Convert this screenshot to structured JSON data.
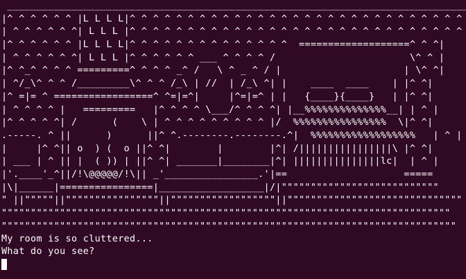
{
  "terminal": {
    "background_color": "#300a24",
    "text_color": "#ffffff",
    "art_lines": [
      " _______________________________________________________________________________________",
      "|^ ^ ^ ^ ^ ^ |L L L L|^ ^ ^ ^ ^ ^ ^ ^ ^ ^ ^ ^ ^ ^ ^ ^ ^ ^ ^ ^ ^ ^ ^ ^ ^ ^ ^ ^ ^ ^ ^ |",
      "| ^ ^ ^ ^ ^ ^| L L L |^ ^ ^ ^ ^ ^ ^ ^ ^ ^ ^ ^ ^ ^ ^ ^ ^ ^ ^ ^ ^ ^ ^ ^ ^ ^ ^ ^ ^ ^ |",
      "|^ ^ ^ ^ ^ ^ |L L L L|^ ^ ^ ^ ^ ^ ^ ^ ^ ^ ^ ^ ^ ^  ===================^ ^ ^|",
      "| ^ ^ ^ ^ ^ ^| L L L |^ ^ ^ ^ ^ ^ ___ ^ ^ ^ ^ /                       \\^ ^ |",
      "|^ ^_^ ^ ^ ^ =========^ ^ ^ ^ _^ /   \\ ^ _ ^ / |                     | \\^ ^|",
      "| ^/_\\^ ^ ^ /_________\\^ ^ ^ /_\\ | //  | /_\\ ^| |    ____  ____    | |^ ^|",
      "|^ =|= ^ =================^ ^=|=^|     |^=|=^ | |   {____}{____}   | |^ ^|",
      "| ^ ^ ^ ^ |   =========   |^ ^ ^ ^ \\___/^ ^ ^ ^| |__%%%%%%%%%%%%%%__| | ^ |",
      "|^ ^ ^ ^ ^| /      (    \\ | ^ ^ ^ ^ ^ ^ ^ ^ ^ |/  %%%%%%%%%%%%%%%%  \\|^ ^|",
      ".-----. ^ ||      )      ||^ ^.--------.--------.^|  %%%%%%%%%%%%%%%%%%   | ^ |",
      "|     |^ ^|| o  ) (  o ||^ ^|        |        |^| /||||||||||||||||\\ |^ ^|",
      "| ___ | ^ || |  ( )) | ||^ ^| _______|________|^| |||||||||||||||lc|  | ^ |",
      "|'.____'_^||/!\\@@@@@/!\\|| _'________________.'|==                    =====",
      "|\\|______|================|__________________|/|\"\"\"\"\"\"\"\"\"\"\"\"\"\"\"\"\"\"\"\"\"\"\"\"\"\"\"",
      "\" ||\"\"\"\"\"||\"\"\"\"\"\"\"\"\"\"\"\"\"\"\"\"||\"\"\"\"\"\"\"\"\"\"\"\"\"\"\"\"\"\"||\"\"\"\"\"\"\"\"\"\"\"\"\"\"\"\"\"\"\"\"\"\"\"\"\"\"\"\"\"\"",
      "\"\"\"\"\"\"\"\"\"\"\"\"\"\"\"\"\"\"\"\"\"\"\"\"\"\"\"\"\"\"\"\"\"\"\"\"\"\"\"\"\"\"\"\"\"\"\"\"\"\"\"\"\"\"\"\"\"\"\"\"\"\"\"\"\"\"\"\"\"\"\"\"\"\"\"\"\"",
      "\"\"\"\"\"\"\"\"\"\"\"\"\"\"\"\"\"\"\"\"\"\"\"\"\"\"\"\"\"\"\"\"\"\"\"\"\"\"\"\"\"\"\"\"\"\"\"\"\"\"\"\"\"\"\"\"\"\"\"\"\"\"\"\"\"\"\"\"\"\"\"\"\"\"\"\"\"\"",
      "\"\"\"\"\"\"\"\"\"\"\"\"\"\"\"\"\"\"\"\"\"\"\"\"\"\"\"\"\"\"\"\"\"\"\"\"\"\"\"\"\"\"\"\"\"\"\"\"\"\"\"\"\"\"\"\"\"\"\"\"\"\"\"\"\"\"\"\"\"\"\"\"\"\"\"\"\""
    ],
    "message_line_1": "My room is so cluttered...",
    "message_line_2": "What do you see?"
  }
}
